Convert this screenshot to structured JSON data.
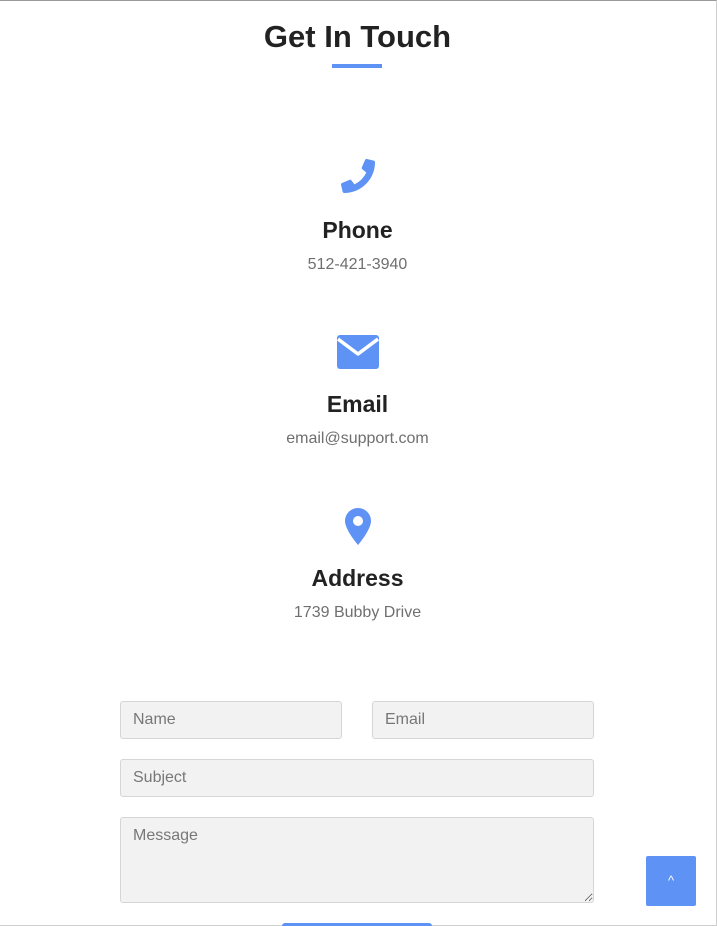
{
  "section": {
    "title": "Get In Touch",
    "accent_color": "#5f92f5"
  },
  "contact": {
    "phone": {
      "icon": "phone-icon",
      "heading": "Phone",
      "value": "512-421-3940"
    },
    "email": {
      "icon": "envelope-icon",
      "heading": "Email",
      "value": "email@support.com"
    },
    "address": {
      "icon": "map-pin-icon",
      "heading": "Address",
      "value": "1739 Bubby Drive"
    }
  },
  "form": {
    "name_placeholder": "Name",
    "email_placeholder": "Email",
    "subject_placeholder": "Subject",
    "message_placeholder": "Message",
    "submit_label": ""
  },
  "back_to_top": {
    "icon": "chevron-up-icon",
    "label": "^"
  }
}
